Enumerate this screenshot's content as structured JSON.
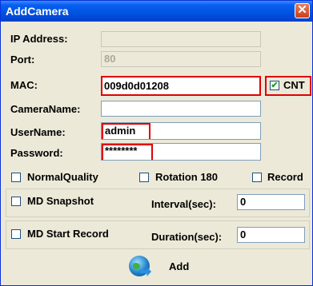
{
  "window": {
    "title": "AddCamera",
    "close_glyph": "✕"
  },
  "fields": {
    "ip_address": {
      "label": "IP Address:",
      "value": ""
    },
    "port": {
      "label": "Port:",
      "value": "80"
    },
    "mac": {
      "label": "MAC:",
      "value": "009d0d01208"
    },
    "camera_name": {
      "label": "CameraName:",
      "value": ""
    },
    "username": {
      "label": "UserName:",
      "value": "admin"
    },
    "password": {
      "label": "Password:",
      "value": "********"
    }
  },
  "checkboxes": {
    "cnt": {
      "label": "CNT",
      "checked": true
    },
    "normal_quality": {
      "label": "NormalQuality",
      "checked": false
    },
    "rotation_180": {
      "label": "Rotation 180",
      "checked": false
    },
    "record": {
      "label": "Record",
      "checked": false
    },
    "md_snapshot": {
      "label": "MD Snapshot",
      "checked": false
    },
    "md_start_record": {
      "label": "MD Start Record",
      "checked": false
    }
  },
  "interval": {
    "label": "Interval(sec):",
    "value": "0"
  },
  "duration": {
    "label": "Duration(sec):",
    "value": "0"
  },
  "add_button": {
    "label": "Add",
    "icon": "globe-arrow-icon"
  },
  "colors": {
    "highlight": "#e00000",
    "titlebar": "#0054e3",
    "check": "#21a121"
  }
}
